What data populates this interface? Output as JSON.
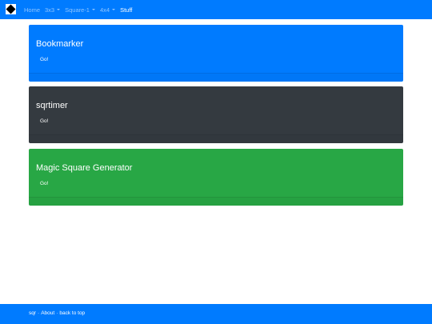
{
  "navbar": {
    "brand_icon": "diamond-square-logo",
    "items": [
      {
        "label": "Home",
        "dropdown": false,
        "active": false
      },
      {
        "label": "3x3",
        "dropdown": true,
        "active": false
      },
      {
        "label": "Square-1",
        "dropdown": true,
        "active": false
      },
      {
        "label": "4x4",
        "dropdown": true,
        "active": false
      },
      {
        "label": "Stuff",
        "dropdown": false,
        "active": true
      }
    ]
  },
  "cards": [
    {
      "title": "Bookmarker",
      "button": "Go!",
      "color": "#007bff"
    },
    {
      "title": "sqrtimer",
      "button": "Go!",
      "color": "#343a40"
    },
    {
      "title": "Magic Square Generator",
      "button": "Go!",
      "color": "#28a745"
    }
  ],
  "footer": {
    "links": [
      "sqr",
      "About",
      "back to top"
    ],
    "separator": "·"
  },
  "colors": {
    "primary": "#007bff",
    "dark": "#343a40",
    "success": "#28a745"
  }
}
